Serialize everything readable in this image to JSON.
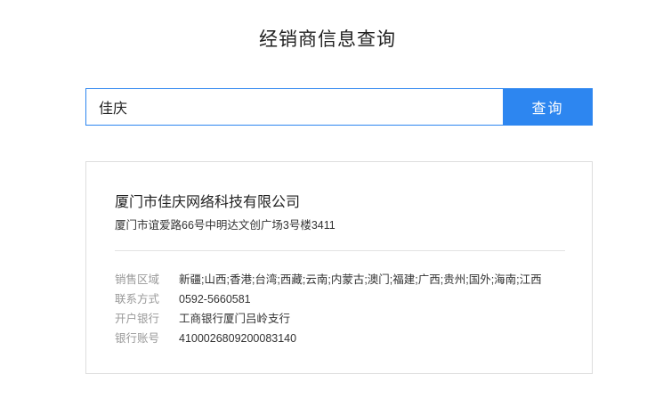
{
  "header": {
    "title": "经销商信息查询"
  },
  "search": {
    "value": "佳庆",
    "button_label": "查询"
  },
  "result": {
    "company_name": "厦门市佳庆网络科技有限公司",
    "address": "厦门市谊爱路66号中明达文创广场3号楼3411",
    "fields": [
      {
        "label": "销售区域",
        "value": "新疆;山西;香港;台湾;西藏;云南;内蒙古;澳门;福建;广西;贵州;国外;海南;江西"
      },
      {
        "label": "联系方式",
        "value": "0592-5660581"
      },
      {
        "label": "开户银行",
        "value": "工商银行厦门吕岭支行"
      },
      {
        "label": "银行账号",
        "value": "4100026809200083140"
      }
    ]
  },
  "colors": {
    "accent": "#2d86f0",
    "label_gray": "#999999",
    "card_border": "#dddddd"
  }
}
